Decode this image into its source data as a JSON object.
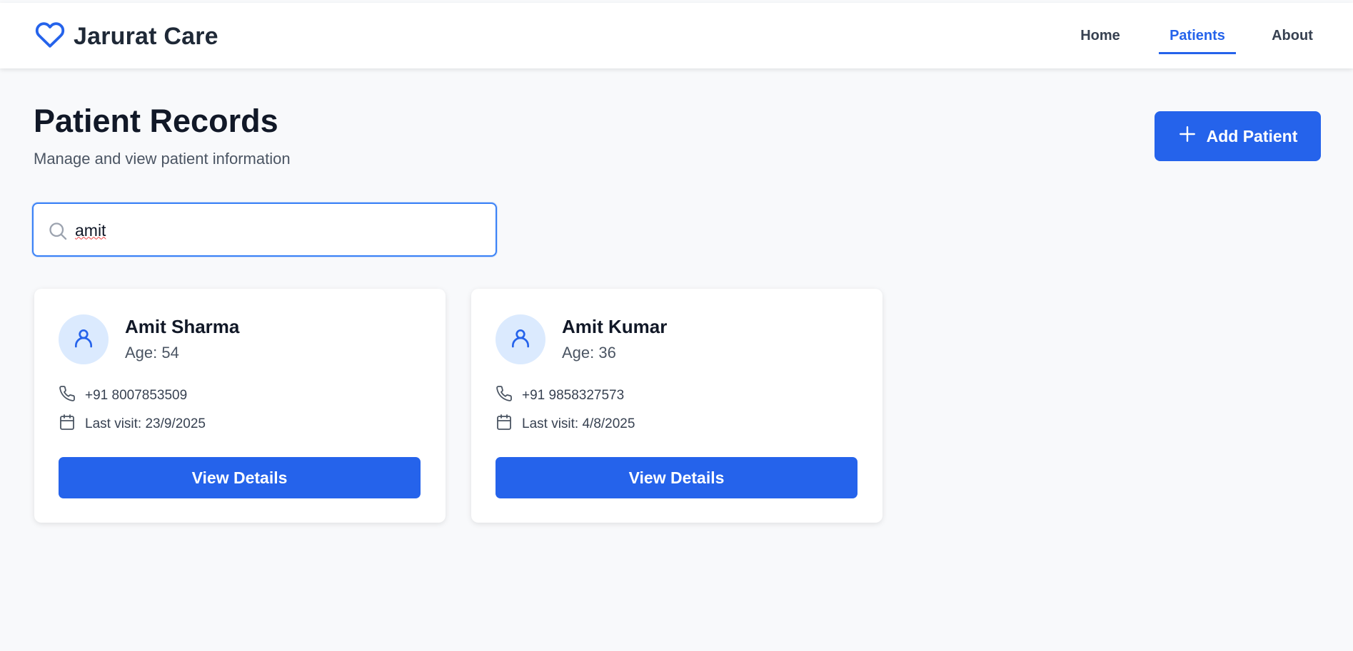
{
  "header": {
    "brand_name": "Jarurat Care",
    "brand_icon": "heart-icon",
    "nav": [
      {
        "label": "Home",
        "active": false
      },
      {
        "label": "Patients",
        "active": true
      },
      {
        "label": "About",
        "active": false
      }
    ]
  },
  "page": {
    "title": "Patient Records",
    "subtitle": "Manage and view patient information",
    "add_button_label": "Add Patient"
  },
  "search": {
    "value": "amit",
    "icon": "search-icon"
  },
  "patients": [
    {
      "name": "Amit Sharma",
      "age": "Age: 54",
      "phone": "+91 8007853509",
      "last_visit": "Last visit: 23/9/2025",
      "button_label": "View Details"
    },
    {
      "name": "Amit Kumar",
      "age": "Age: 36",
      "phone": "+91 9858327573",
      "last_visit": "Last visit: 4/8/2025",
      "button_label": "View Details"
    }
  ],
  "colors": {
    "accent": "#2563eb",
    "avatar_bg": "#dbeafe",
    "page_bg": "#f8f9fb"
  }
}
